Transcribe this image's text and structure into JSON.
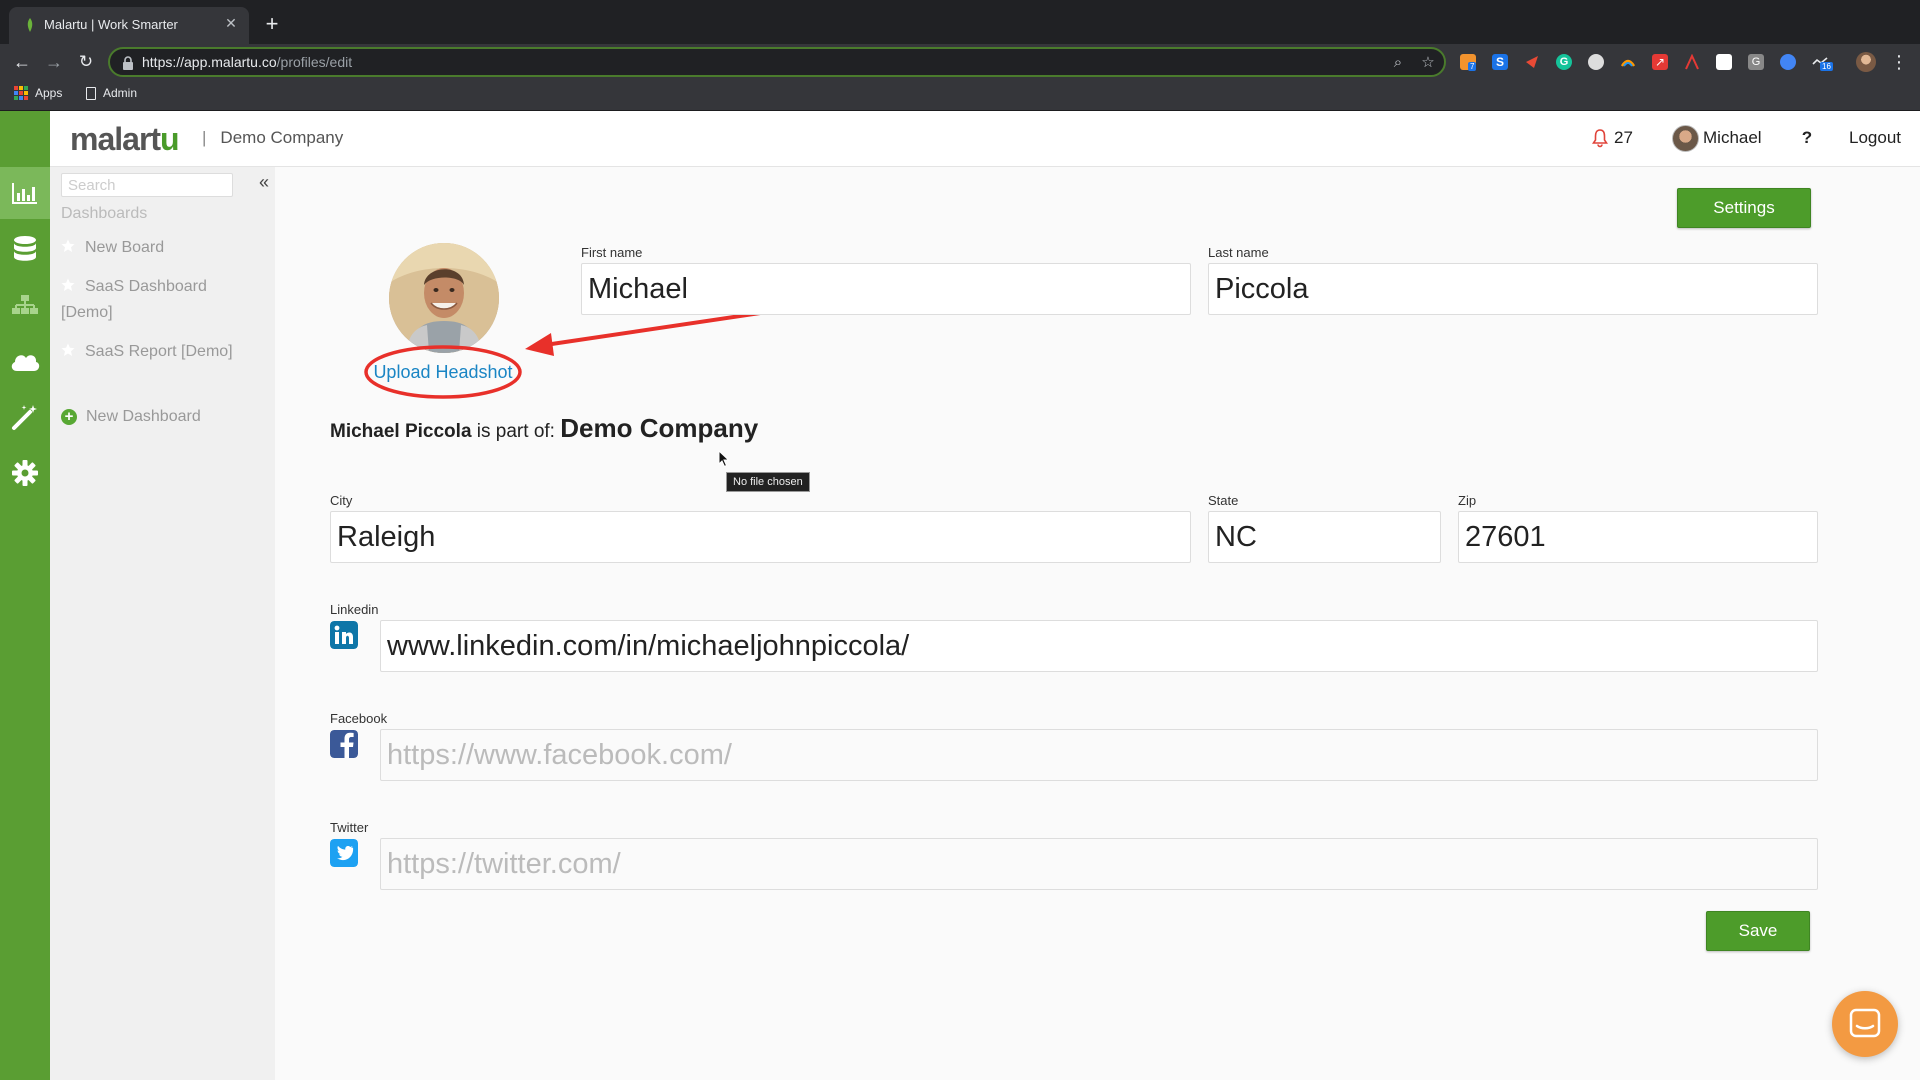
{
  "browser": {
    "tab_title": "Malartu | Work Smarter",
    "url_host": "https://app.malartu.co",
    "url_path": "/profiles/edit",
    "bookmarks": [
      {
        "label": "Apps",
        "icon": "apps-grid-icon"
      },
      {
        "label": "Admin",
        "icon": "page-icon"
      }
    ],
    "extension_badges": [
      "7",
      "16"
    ]
  },
  "header": {
    "logo_text_main": "malart",
    "logo_text_accent": "u",
    "company_separator": "|",
    "company": "Demo Company",
    "notification_count": "27",
    "user_name": "Michael",
    "help": "?",
    "logout": "Logout"
  },
  "rail": {
    "items": [
      {
        "icon": "bar-chart-icon",
        "active": true
      },
      {
        "icon": "database-icon",
        "active": false
      },
      {
        "icon": "org-chart-icon",
        "active": false
      },
      {
        "icon": "cloud-icon",
        "active": false
      },
      {
        "icon": "magic-wand-icon",
        "active": false
      },
      {
        "icon": "gear-icon",
        "active": false
      }
    ]
  },
  "sidebar": {
    "search_placeholder": "Search",
    "heading": "Dashboards",
    "items": [
      {
        "label": "New Board",
        "icon": "star-icon"
      },
      {
        "label": "SaaS Dashboard [Demo]",
        "icon": "star-icon"
      },
      {
        "label": "SaaS Report [Demo]",
        "icon": "star-icon"
      },
      {
        "label": "New Dashboard",
        "icon": "plus-circle-icon"
      }
    ]
  },
  "profile": {
    "settings_label": "Settings",
    "upload_label": "Upload Headshot",
    "first_name_label": "First name",
    "first_name": "Michael",
    "last_name_label": "Last name",
    "last_name": "Piccola",
    "member_name": "Michael Piccola",
    "member_text": "is part of:",
    "member_company": "Demo Company",
    "file_tooltip": "No file chosen",
    "city_label": "City",
    "city": "Raleigh",
    "state_label": "State",
    "state": "NC",
    "zip_label": "Zip",
    "zip": "27601",
    "linkedin_label": "Linkedin",
    "linkedin": "www.linkedin.com/in/michaeljohnpiccola/",
    "facebook_label": "Facebook",
    "facebook_placeholder": "https://www.facebook.com/",
    "twitter_label": "Twitter",
    "twitter_placeholder": "https://twitter.com/",
    "save_label": "Save"
  },
  "colors": {
    "brand_green": "#5a9e33",
    "button_green": "#4d9c2a",
    "link_blue": "#1a85c4",
    "annotation_red": "#e8302a",
    "linkedin_blue": "#0e76a8",
    "facebook_blue": "#3b5998",
    "twitter_blue": "#1da1f2",
    "chat_orange": "#f39a42"
  }
}
